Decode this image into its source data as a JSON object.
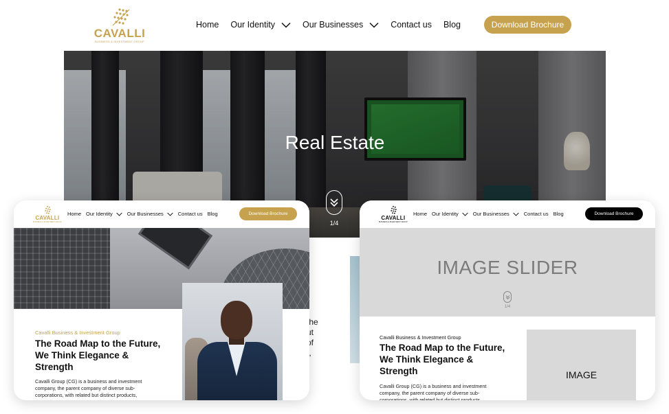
{
  "colors": {
    "gold": "#c6a24e",
    "black": "#000000",
    "placeholder_gray": "#d9d9d9"
  },
  "site": {
    "logo": {
      "name": "CAVALLI",
      "tagline": "BUSINESS & INVESTMENT GROUP"
    },
    "nav": {
      "home": "Home",
      "identity": "Our Identity",
      "businesses": "Our Businesses",
      "contact": "Contact us",
      "blog": "Blog"
    },
    "brochure_button": "Download Brochure",
    "hero": {
      "title": "Real Estate",
      "counter": "1/4"
    },
    "background_text_fragments": [
      "the",
      "ut",
      "of",
      "t,"
    ]
  },
  "left_card": {
    "eyebrow": "Cavalli Business & Investment Group",
    "heading": "The Road Map to the Future, We Think Elegance & Strength",
    "body": "Cavalli Group (CG) is a business and investment company, the parent company of diverse sub-corporations, with related but distinct products,"
  },
  "right_card": {
    "slider_label": "IMAGE SLIDER",
    "counter": "1/4",
    "eyebrow": "Cavalli Business & Investment Group",
    "heading": "The Road Map to the Future, We Think Elegance & Strength",
    "body": "Cavalli Group (CG) is a business and investment company, the parent company of diverse sub-corporations, with related but distinct products,",
    "image_label": "IMAGE"
  }
}
